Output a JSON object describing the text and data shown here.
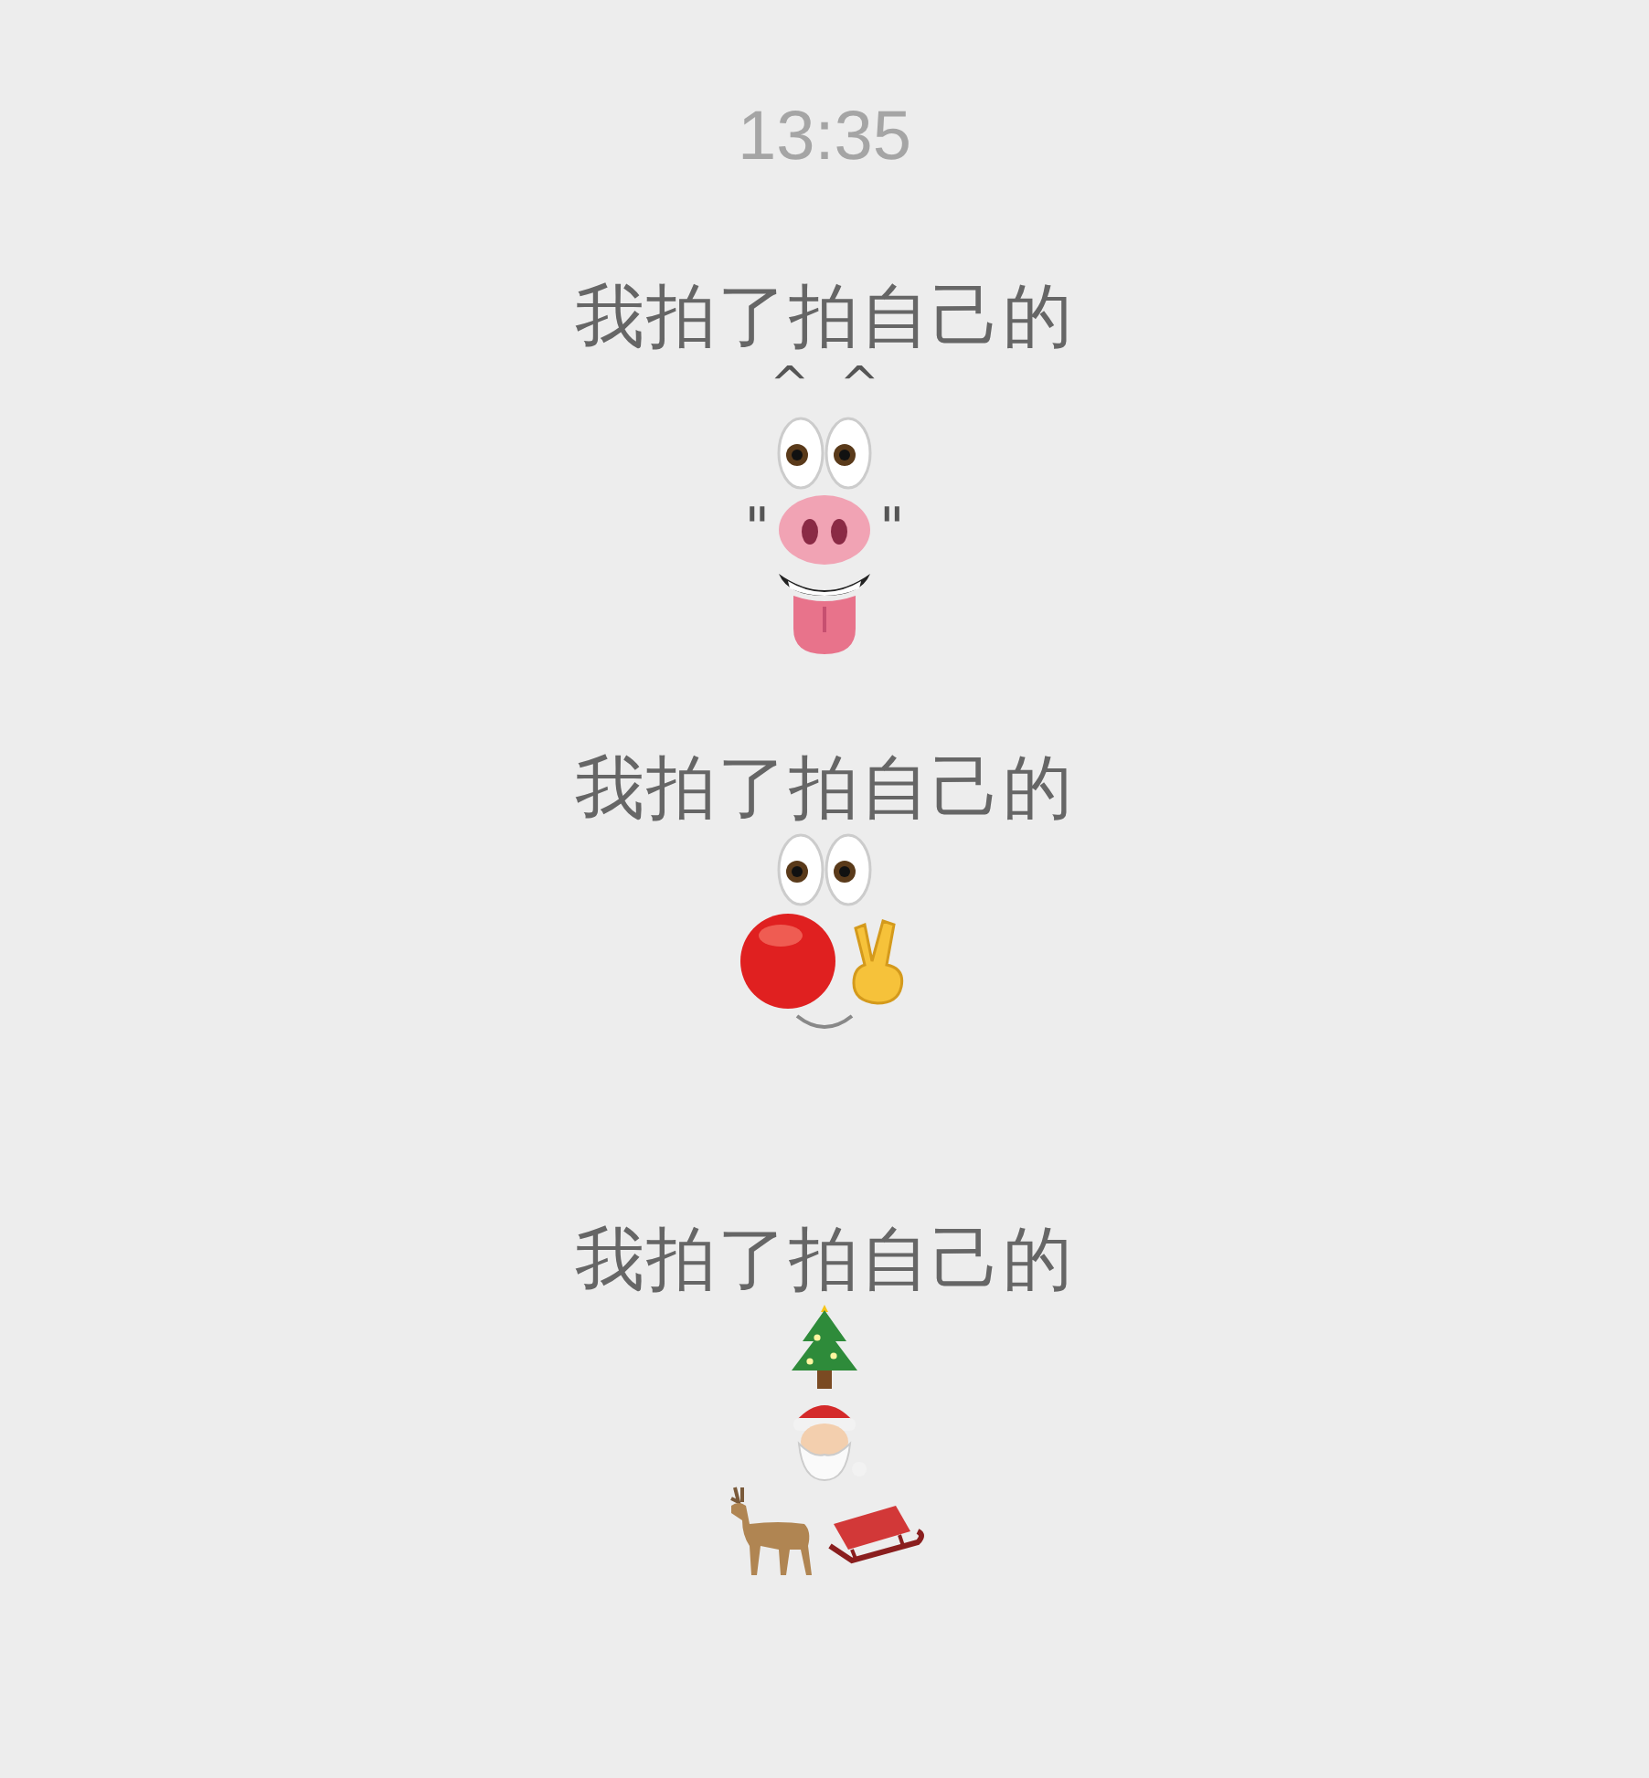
{
  "time": "13:35",
  "messages": [
    {
      "text": "我拍了拍自己的",
      "art": [
        {
          "kind": "caret",
          "text": "^  ^"
        },
        {
          "kind": "eyes"
        },
        {
          "kind": "nose",
          "left": "\"",
          "right": "\""
        },
        {
          "kind": "tongue"
        }
      ]
    },
    {
      "text": "我拍了拍自己的",
      "art": [
        {
          "kind": "eyes"
        },
        {
          "kind": "clown"
        },
        {
          "kind": "smile"
        }
      ]
    },
    {
      "text": "我拍了拍自己的",
      "art": [
        {
          "kind": "tree"
        },
        {
          "kind": "santa"
        },
        {
          "kind": "sleigh"
        }
      ]
    }
  ]
}
